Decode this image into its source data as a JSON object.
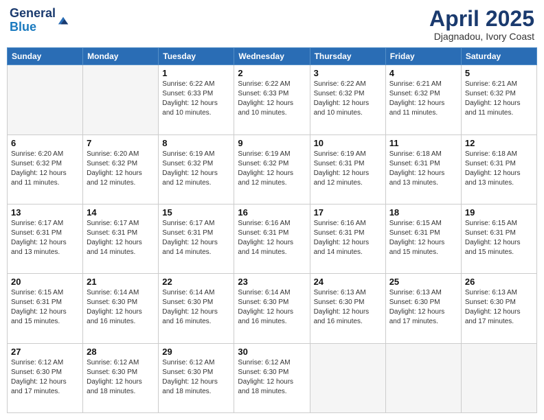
{
  "header": {
    "logo_general": "General",
    "logo_blue": "Blue",
    "main_title": "April 2025",
    "subtitle": "Djagnadou, Ivory Coast"
  },
  "days_of_week": [
    "Sunday",
    "Monday",
    "Tuesday",
    "Wednesday",
    "Thursday",
    "Friday",
    "Saturday"
  ],
  "weeks": [
    [
      {
        "day": "",
        "info": ""
      },
      {
        "day": "",
        "info": ""
      },
      {
        "day": "1",
        "info": "Sunrise: 6:22 AM\nSunset: 6:33 PM\nDaylight: 12 hours and 10 minutes."
      },
      {
        "day": "2",
        "info": "Sunrise: 6:22 AM\nSunset: 6:33 PM\nDaylight: 12 hours and 10 minutes."
      },
      {
        "day": "3",
        "info": "Sunrise: 6:22 AM\nSunset: 6:32 PM\nDaylight: 12 hours and 10 minutes."
      },
      {
        "day": "4",
        "info": "Sunrise: 6:21 AM\nSunset: 6:32 PM\nDaylight: 12 hours and 11 minutes."
      },
      {
        "day": "5",
        "info": "Sunrise: 6:21 AM\nSunset: 6:32 PM\nDaylight: 12 hours and 11 minutes."
      }
    ],
    [
      {
        "day": "6",
        "info": "Sunrise: 6:20 AM\nSunset: 6:32 PM\nDaylight: 12 hours and 11 minutes."
      },
      {
        "day": "7",
        "info": "Sunrise: 6:20 AM\nSunset: 6:32 PM\nDaylight: 12 hours and 12 minutes."
      },
      {
        "day": "8",
        "info": "Sunrise: 6:19 AM\nSunset: 6:32 PM\nDaylight: 12 hours and 12 minutes."
      },
      {
        "day": "9",
        "info": "Sunrise: 6:19 AM\nSunset: 6:32 PM\nDaylight: 12 hours and 12 minutes."
      },
      {
        "day": "10",
        "info": "Sunrise: 6:19 AM\nSunset: 6:31 PM\nDaylight: 12 hours and 12 minutes."
      },
      {
        "day": "11",
        "info": "Sunrise: 6:18 AM\nSunset: 6:31 PM\nDaylight: 12 hours and 13 minutes."
      },
      {
        "day": "12",
        "info": "Sunrise: 6:18 AM\nSunset: 6:31 PM\nDaylight: 12 hours and 13 minutes."
      }
    ],
    [
      {
        "day": "13",
        "info": "Sunrise: 6:17 AM\nSunset: 6:31 PM\nDaylight: 12 hours and 13 minutes."
      },
      {
        "day": "14",
        "info": "Sunrise: 6:17 AM\nSunset: 6:31 PM\nDaylight: 12 hours and 14 minutes."
      },
      {
        "day": "15",
        "info": "Sunrise: 6:17 AM\nSunset: 6:31 PM\nDaylight: 12 hours and 14 minutes."
      },
      {
        "day": "16",
        "info": "Sunrise: 6:16 AM\nSunset: 6:31 PM\nDaylight: 12 hours and 14 minutes."
      },
      {
        "day": "17",
        "info": "Sunrise: 6:16 AM\nSunset: 6:31 PM\nDaylight: 12 hours and 14 minutes."
      },
      {
        "day": "18",
        "info": "Sunrise: 6:15 AM\nSunset: 6:31 PM\nDaylight: 12 hours and 15 minutes."
      },
      {
        "day": "19",
        "info": "Sunrise: 6:15 AM\nSunset: 6:31 PM\nDaylight: 12 hours and 15 minutes."
      }
    ],
    [
      {
        "day": "20",
        "info": "Sunrise: 6:15 AM\nSunset: 6:31 PM\nDaylight: 12 hours and 15 minutes."
      },
      {
        "day": "21",
        "info": "Sunrise: 6:14 AM\nSunset: 6:30 PM\nDaylight: 12 hours and 16 minutes."
      },
      {
        "day": "22",
        "info": "Sunrise: 6:14 AM\nSunset: 6:30 PM\nDaylight: 12 hours and 16 minutes."
      },
      {
        "day": "23",
        "info": "Sunrise: 6:14 AM\nSunset: 6:30 PM\nDaylight: 12 hours and 16 minutes."
      },
      {
        "day": "24",
        "info": "Sunrise: 6:13 AM\nSunset: 6:30 PM\nDaylight: 12 hours and 16 minutes."
      },
      {
        "day": "25",
        "info": "Sunrise: 6:13 AM\nSunset: 6:30 PM\nDaylight: 12 hours and 17 minutes."
      },
      {
        "day": "26",
        "info": "Sunrise: 6:13 AM\nSunset: 6:30 PM\nDaylight: 12 hours and 17 minutes."
      }
    ],
    [
      {
        "day": "27",
        "info": "Sunrise: 6:12 AM\nSunset: 6:30 PM\nDaylight: 12 hours and 17 minutes."
      },
      {
        "day": "28",
        "info": "Sunrise: 6:12 AM\nSunset: 6:30 PM\nDaylight: 12 hours and 18 minutes."
      },
      {
        "day": "29",
        "info": "Sunrise: 6:12 AM\nSunset: 6:30 PM\nDaylight: 12 hours and 18 minutes."
      },
      {
        "day": "30",
        "info": "Sunrise: 6:12 AM\nSunset: 6:30 PM\nDaylight: 12 hours and 18 minutes."
      },
      {
        "day": "",
        "info": ""
      },
      {
        "day": "",
        "info": ""
      },
      {
        "day": "",
        "info": ""
      }
    ]
  ]
}
